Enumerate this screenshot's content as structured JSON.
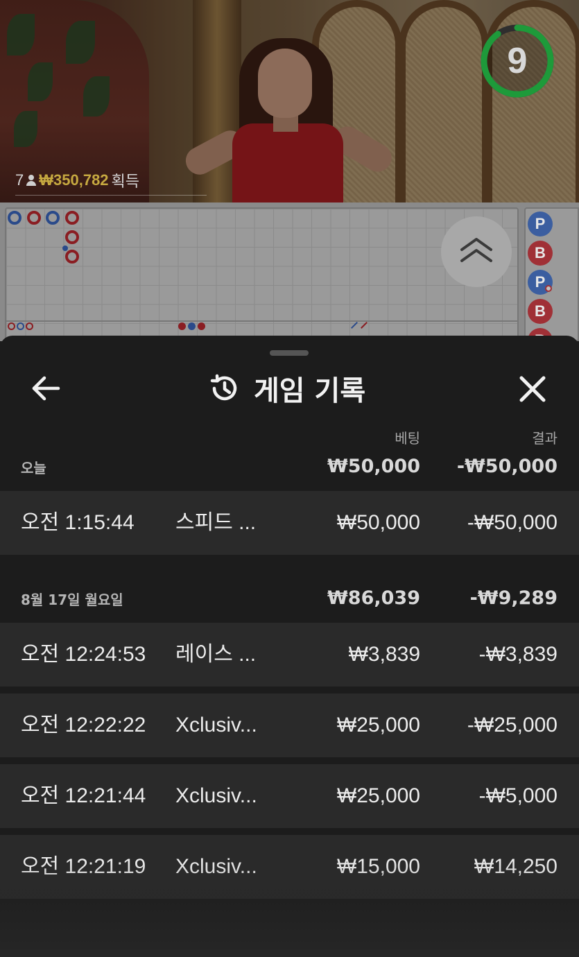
{
  "video": {
    "countdown": "9",
    "countdown_progress": 0.9,
    "player_count": "7",
    "win_amount": "₩350,782",
    "win_label": "획득"
  },
  "roadmap": {
    "bead_labels": [
      "P",
      "B",
      "P",
      "B",
      "B"
    ],
    "expand_icon": "double-chevron-up-icon"
  },
  "history": {
    "title": "게임 기록",
    "title_icon": "history-icon",
    "back_icon": "arrow-left-icon",
    "close_icon": "close-icon",
    "column_bet": "베팅",
    "column_result": "결과",
    "groups": [
      {
        "label": "오늘",
        "total_bet": "₩50,000",
        "total_result": "-₩50,000",
        "rows": [
          {
            "time": "오전 1:15:44",
            "game": "스피드 ...",
            "bet": "₩50,000",
            "result": "-₩50,000"
          }
        ]
      },
      {
        "label": "8월 17일 월요일",
        "total_bet": "₩86,039",
        "total_result": "-₩9,289",
        "rows": [
          {
            "time": "오전 12:24:53",
            "game": "레이스 ...",
            "bet": "₩3,839",
            "result": "-₩3,839"
          },
          {
            "time": "오전 12:22:22",
            "game": "Xclusiv...",
            "bet": "₩25,000",
            "result": "-₩25,000"
          },
          {
            "time": "오전 12:21:44",
            "game": "Xclusiv...",
            "bet": "₩25,000",
            "result": "-₩5,000"
          },
          {
            "time": "오전 12:21:19",
            "game": "Xclusiv...",
            "bet": "₩15,000",
            "result": "₩14,250"
          }
        ]
      }
    ]
  },
  "colors": {
    "sheet_background": "#1c1c1c",
    "row_background": "#2a2a2a",
    "timer_ring": "#1e9a3a",
    "win_amount": "#c6a940",
    "player_bead": "#3b5ea0",
    "banker_bead": "#a03036"
  }
}
